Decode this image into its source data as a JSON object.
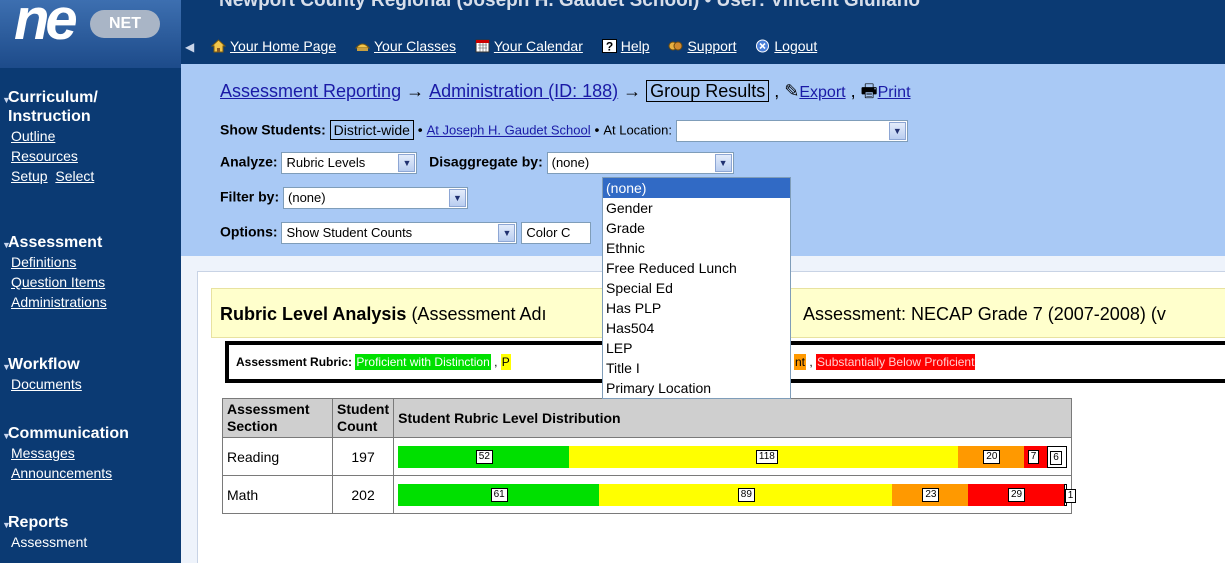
{
  "topbar": {
    "title": "Newport County Regional (Joseph H. Gaudet School) • User: Vincent Giuliano",
    "nav": [
      "Your Home Page",
      "Your Classes",
      "Your Calendar",
      "Help",
      "Support",
      "Logout"
    ]
  },
  "logo": {
    "mark": "ne",
    "badge": "NET"
  },
  "sidebar": {
    "sections": [
      {
        "title": "Curriculum/\nInstruction",
        "links": [
          "Outline",
          "Resources"
        ],
        "inline_links": [
          "Setup",
          "Select"
        ]
      },
      {
        "title": "Assessment",
        "links": [
          "Definitions",
          "Question Items",
          "Administrations"
        ]
      },
      {
        "title": "Workflow",
        "links": [
          "Documents"
        ]
      },
      {
        "title": "Communication",
        "links": [
          "Messages",
          "Announcements"
        ]
      },
      {
        "title": "Reports",
        "links": [
          "Assessment"
        ]
      }
    ]
  },
  "breadcrumb": {
    "items": [
      "Assessment Reporting",
      "Administration (ID: 188)",
      "Group Results"
    ],
    "export": "Export",
    "print": "Print"
  },
  "controls": {
    "show_students_label": "Show Students:",
    "district_wide": "District-wide",
    "school_link": "At Joseph H. Gaudet School",
    "at_location": "At Location:",
    "analyze_label": "Analyze:",
    "analyze_value": "Rubric Levels",
    "disaggregate_label": "Disaggregate by:",
    "disaggregate_value": "(none)",
    "filter_label": "Filter by:",
    "filter_value": "(none)",
    "options_label": "Options:",
    "options_value": "Show Student Counts",
    "color_value": "Color C"
  },
  "disaggregate_options": [
    "(none)",
    "Gender",
    "Grade",
    "Ethnic",
    "Free Reduced Lunch",
    "Special Ed",
    "Has PLP",
    "Has504",
    "LEP",
    "Title I",
    "Primary Location"
  ],
  "banner": {
    "title": "Rubric Level Analysis",
    "sub": "(Assessment Adı",
    "assessment": "Assessment: NECAP Grade 7 (2007-2008) (v"
  },
  "rubric": {
    "label": "Assessment Rubric:",
    "levels": [
      {
        "text": "Proficient with Distinction",
        "color": "#00e000"
      },
      {
        "text": "P",
        "color": "#ffff00"
      },
      {
        "text": "nt",
        "color": "#ff9900"
      },
      {
        "text": "Substantially Below Proficient",
        "color": "#ff0000"
      }
    ]
  },
  "table": {
    "headers": [
      "Assessment Section",
      "Student Count",
      "Student Rubric Level Distribution"
    ],
    "rows": [
      {
        "section": "Reading",
        "count": "197",
        "dist": [
          52,
          118,
          20,
          7,
          6
        ]
      },
      {
        "section": "Math",
        "count": "202",
        "dist": [
          61,
          89,
          23,
          29,
          1
        ]
      }
    ],
    "colors": [
      "#00e000",
      "#ffff00",
      "#ff9900",
      "#ff0000",
      "#ffffff"
    ]
  }
}
